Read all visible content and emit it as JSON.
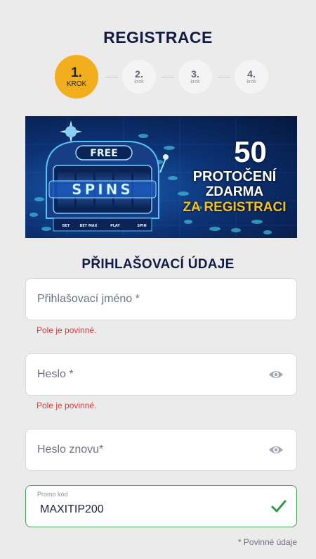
{
  "page": {
    "title": "REGISTRACE"
  },
  "steps": [
    {
      "number": "1.",
      "label": "KROK",
      "active": true
    },
    {
      "number": "2.",
      "label": "krok",
      "active": false
    },
    {
      "number": "3.",
      "label": "krok",
      "active": false
    },
    {
      "number": "4.",
      "label": "krok",
      "active": false
    }
  ],
  "banner": {
    "logo_top": "FREE",
    "logo_main": "SPINS",
    "buttons": [
      "BET",
      "BET MAX",
      "PLAY",
      "SPIN"
    ],
    "amount": "50",
    "line1": "PROTOČENÍ",
    "line2": "ZDARMA",
    "line3": "ZA REGISTRACI",
    "accent_color": "#f5c21a"
  },
  "section": {
    "title": "PŘIHLAŠOVACÍ ÚDAJE"
  },
  "form": {
    "username": {
      "placeholder": "Přihlašovací jméno *",
      "error": "Pole je povinné."
    },
    "password": {
      "placeholder": "Heslo *",
      "error": "Pole je povinné.",
      "icon": "eye-icon"
    },
    "password_repeat": {
      "placeholder": "Heslo znovu*",
      "icon": "eye-icon"
    },
    "promo": {
      "label": "Promo kód",
      "value": "MAXITIP200",
      "icon": "check-icon",
      "status_color": "#2f9a43"
    },
    "required_note": "* Povinné údaje"
  },
  "colors": {
    "accent": "#f2ae1c",
    "error": "#d93a3a",
    "valid": "#49a158"
  }
}
